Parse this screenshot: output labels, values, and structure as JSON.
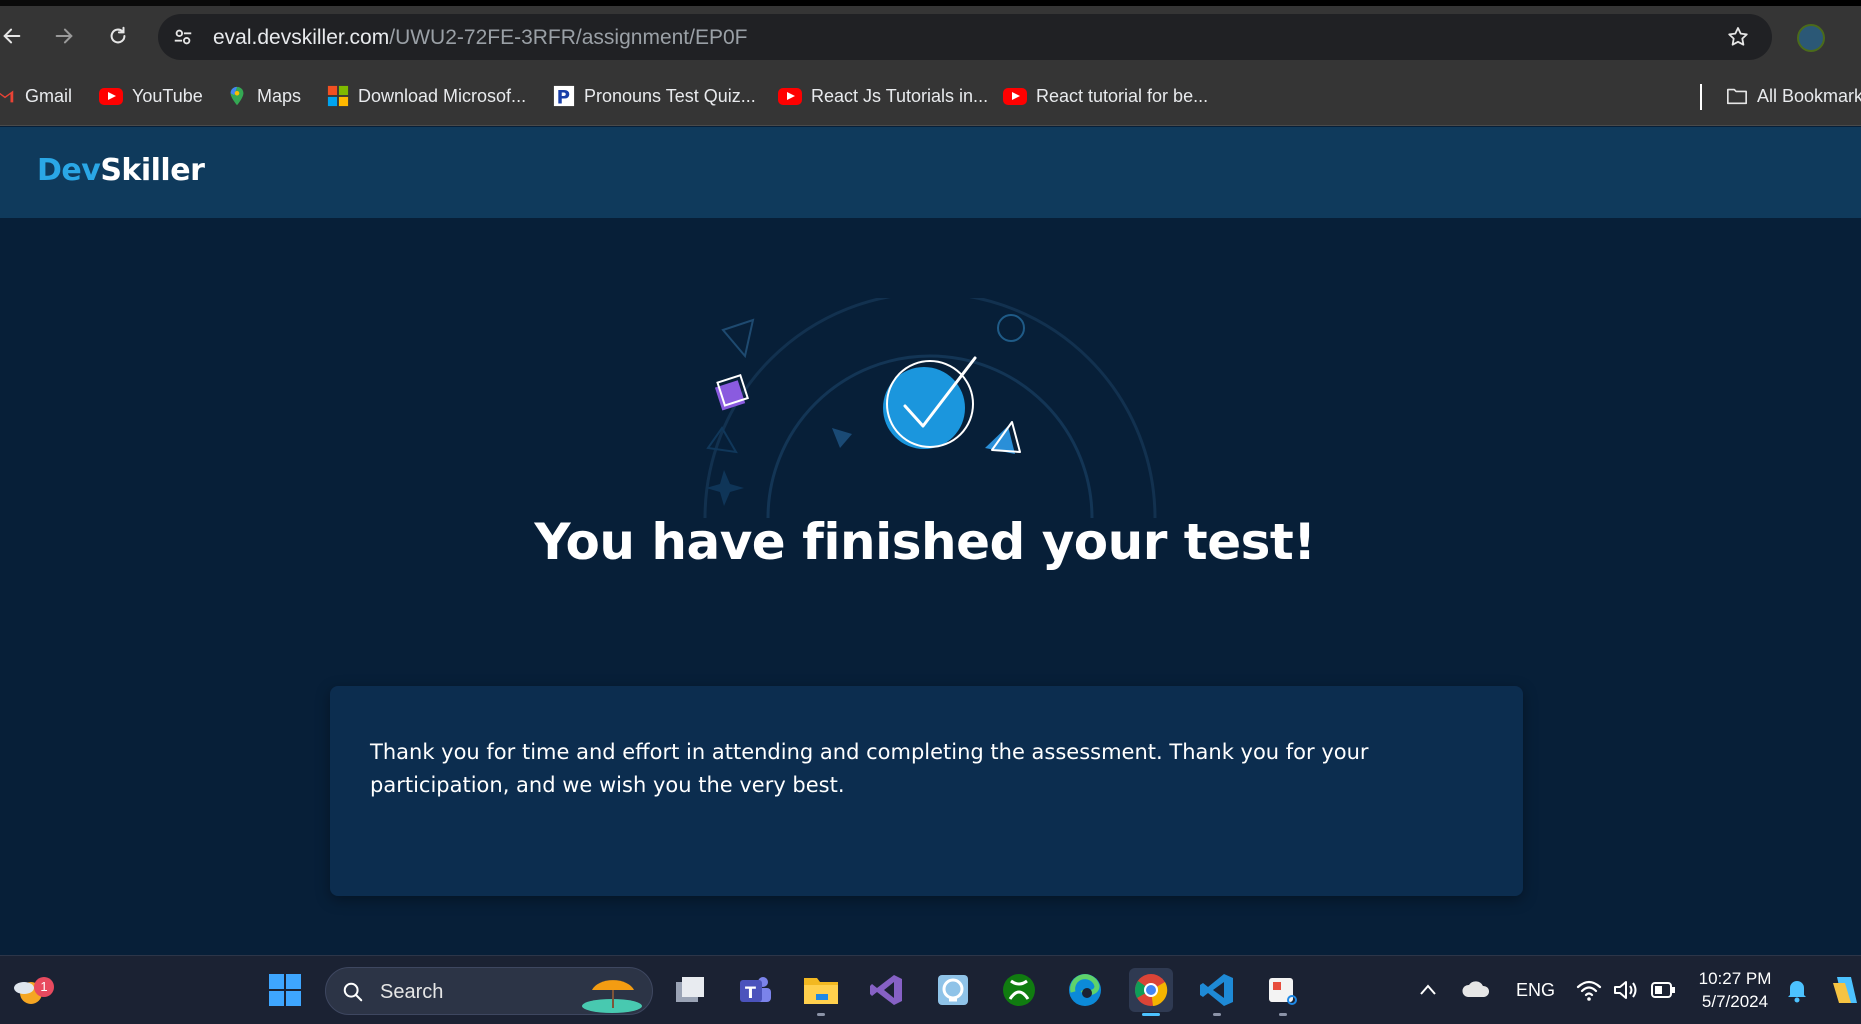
{
  "browser": {
    "url_domain": "eval.devskiller.com",
    "url_path": "/UWU2-72FE-3RFR/assignment/EP0F",
    "bookmarks": [
      {
        "label": "Gmail",
        "icon": "gmail-icon"
      },
      {
        "label": "YouTube",
        "icon": "youtube-icon"
      },
      {
        "label": "Maps",
        "icon": "maps-icon"
      },
      {
        "label": "Download Microsof...",
        "icon": "microsoft-icon"
      },
      {
        "label": "Pronouns Test Quiz...",
        "icon": "p-site-icon"
      },
      {
        "label": "React Js Tutorials in...",
        "icon": "youtube-icon"
      },
      {
        "label": "React tutorial for be...",
        "icon": "youtube-icon"
      }
    ],
    "all_bookmarks_label": "All Bookmarks"
  },
  "site": {
    "logo_part1": "Dev",
    "logo_part2": "Skiller"
  },
  "main": {
    "headline": "You have finished your test!",
    "message": "Thank you for time and effort in attending and completing the assessment. Thank you for your participation, and we wish you the very best."
  },
  "taskbar": {
    "weather_badge": "1",
    "search_label": "Search",
    "apps": [
      "windows-start-icon",
      "task-view-icon",
      "teams-icon",
      "file-explorer-icon",
      "visual-studio-icon",
      "app-icon",
      "xbox-icon",
      "edge-icon",
      "chrome-icon",
      "vscode-icon",
      "snipping-tool-icon"
    ],
    "language": "ENG",
    "time": "10:27 PM",
    "date": "5/7/2024"
  },
  "colors": {
    "header_bg": "#0f3a5c",
    "page_bg": "#071f38",
    "accent": "#2aa7e6",
    "card_bg": "#0c2d4f"
  }
}
